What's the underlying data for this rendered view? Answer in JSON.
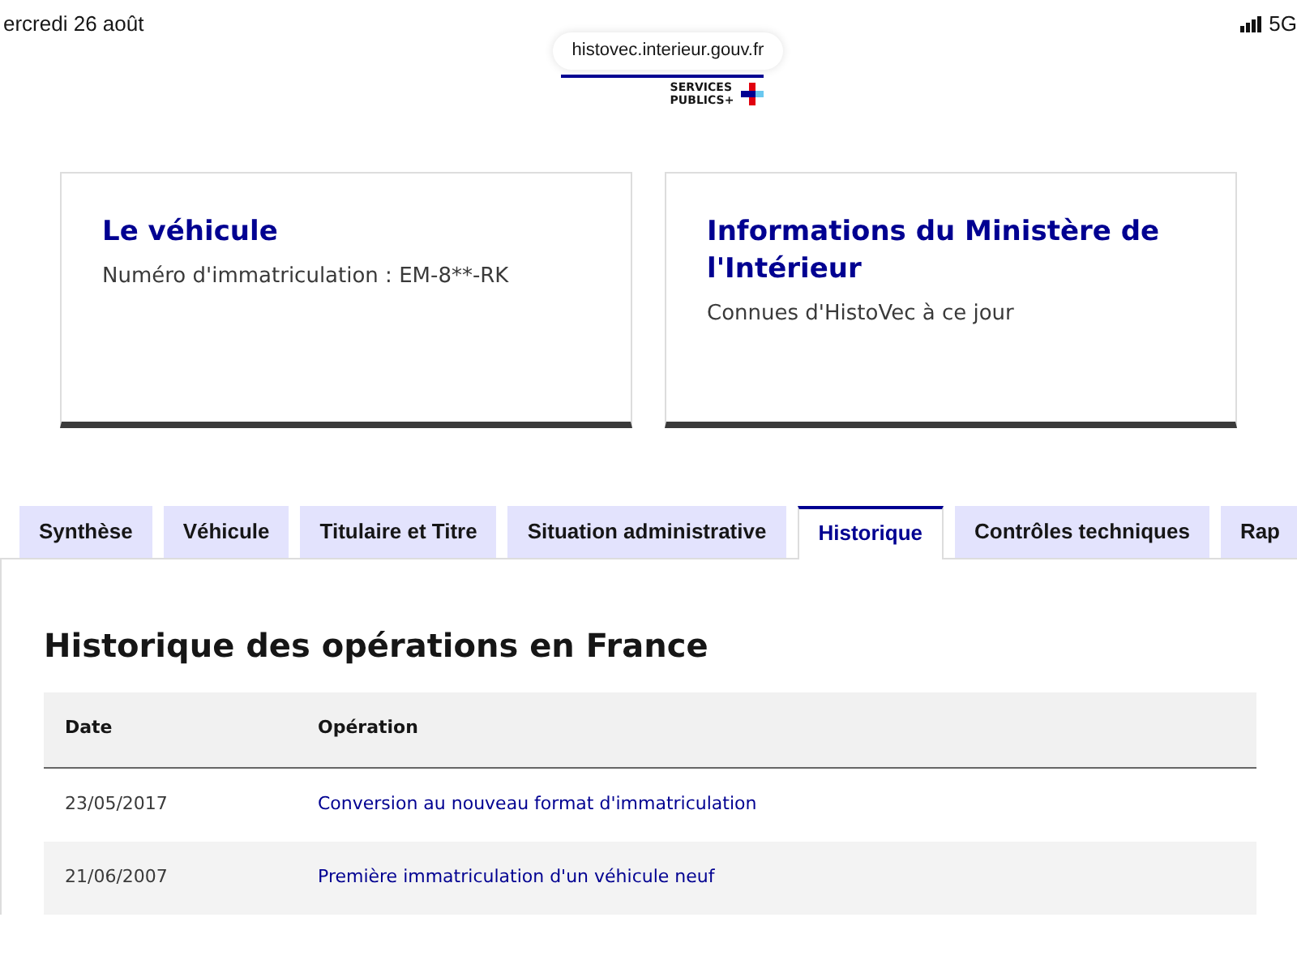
{
  "status_bar": {
    "date": "ercredi 26 août",
    "network": "5G"
  },
  "browser": {
    "url": "histovec.interieur.gouv.fr"
  },
  "logo": {
    "line_1": "SERVICES",
    "line_2": "PUBLICS+"
  },
  "cards": [
    {
      "title": "Le véhicule",
      "text": "Numéro d'immatriculation : EM-8**-RK"
    },
    {
      "title": "Informations du Ministère de l'Intérieur",
      "text": "Connues d'HistoVec à ce jour"
    }
  ],
  "tabs": [
    {
      "label": "Synthèse",
      "selected": false
    },
    {
      "label": "Véhicule",
      "selected": false
    },
    {
      "label": "Titulaire et Titre",
      "selected": false
    },
    {
      "label": "Situation administrative",
      "selected": false
    },
    {
      "label": "Historique",
      "selected": true
    },
    {
      "label": "Contrôles techniques",
      "selected": false
    },
    {
      "label": "Rap",
      "selected": false
    }
  ],
  "section": {
    "title": "Historique des opérations en France"
  },
  "table": {
    "columns": [
      "Date",
      "Opération"
    ],
    "rows": [
      [
        "23/05/2017",
        "Conversion au nouveau format d'immatriculation"
      ],
      [
        "21/06/2007",
        "Première immatriculation d'un véhicule neuf"
      ]
    ]
  }
}
